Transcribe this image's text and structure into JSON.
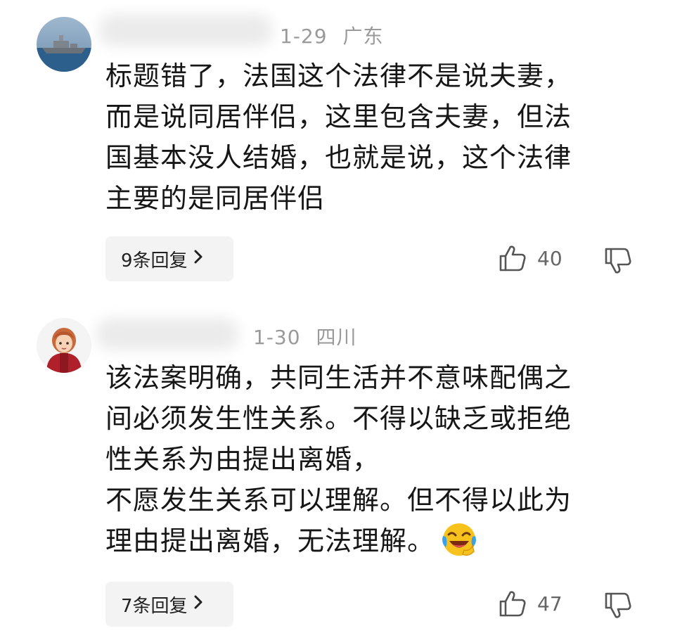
{
  "comments": [
    {
      "date": "1-29",
      "location": "广东",
      "text_lines": [
        "标题错了，法国这个法律不是说夫妻，",
        "而是说同居伴侣，这里包含夫妻，但法",
        "国基本没人结婚，也就是说，这个法律",
        "主要的是同居伴侣"
      ],
      "replies_label": "9条回复",
      "like_count": "40",
      "avatar_icon": "warship-avatar-icon"
    },
    {
      "date": "1-30",
      "location": "四川",
      "text_lines": [
        "该法案明确，共同生活并不意味配偶之",
        "间必须发生性关系。不得以缺乏或拒绝",
        "性关系为由提出离婚，",
        "不愿发生关系可以理解。但不得以此为",
        "理由提出离婚，无法理解。"
      ],
      "emoji_icon": "laughing-crying-emoji-icon",
      "replies_label": "7条回复",
      "like_count": "47",
      "avatar_icon": "cartoon-girl-avatar-icon"
    }
  ],
  "colors": {
    "meta_text": "#9a9a9a",
    "body_text": "#161616",
    "reply_button_bg": "#f3f3f3",
    "icon_gray": "#555555"
  }
}
